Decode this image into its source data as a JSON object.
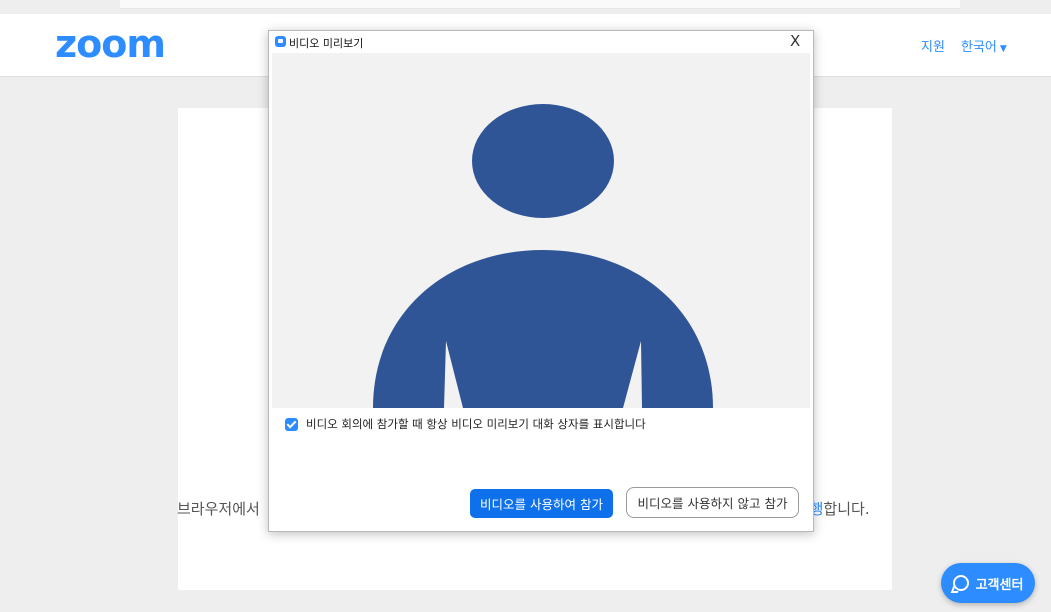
{
  "header": {
    "logo_text": "zoom",
    "support_label": "지원",
    "language_label": "한국어"
  },
  "page": {
    "launch_text_prefix": "브라우저에서",
    "launch_text_link": "실행",
    "launch_text_suffix": "합니다."
  },
  "support_button": {
    "label": "고객센터"
  },
  "dialog": {
    "title": "비디오 미리보기",
    "close_glyph": "X",
    "avatar_color": "#2f5597",
    "checkbox_checked": true,
    "checkbox_label": "비디오 회의에 참가할 때 항상 비디오 미리보기 대화 상자를 표시합니다",
    "join_with_video_label": "비디오를 사용하여 참가",
    "join_without_video_label": "비디오를 사용하지 않고 참가"
  },
  "colors": {
    "brand": "#2d8cff",
    "primary_button": "#0e71eb"
  }
}
